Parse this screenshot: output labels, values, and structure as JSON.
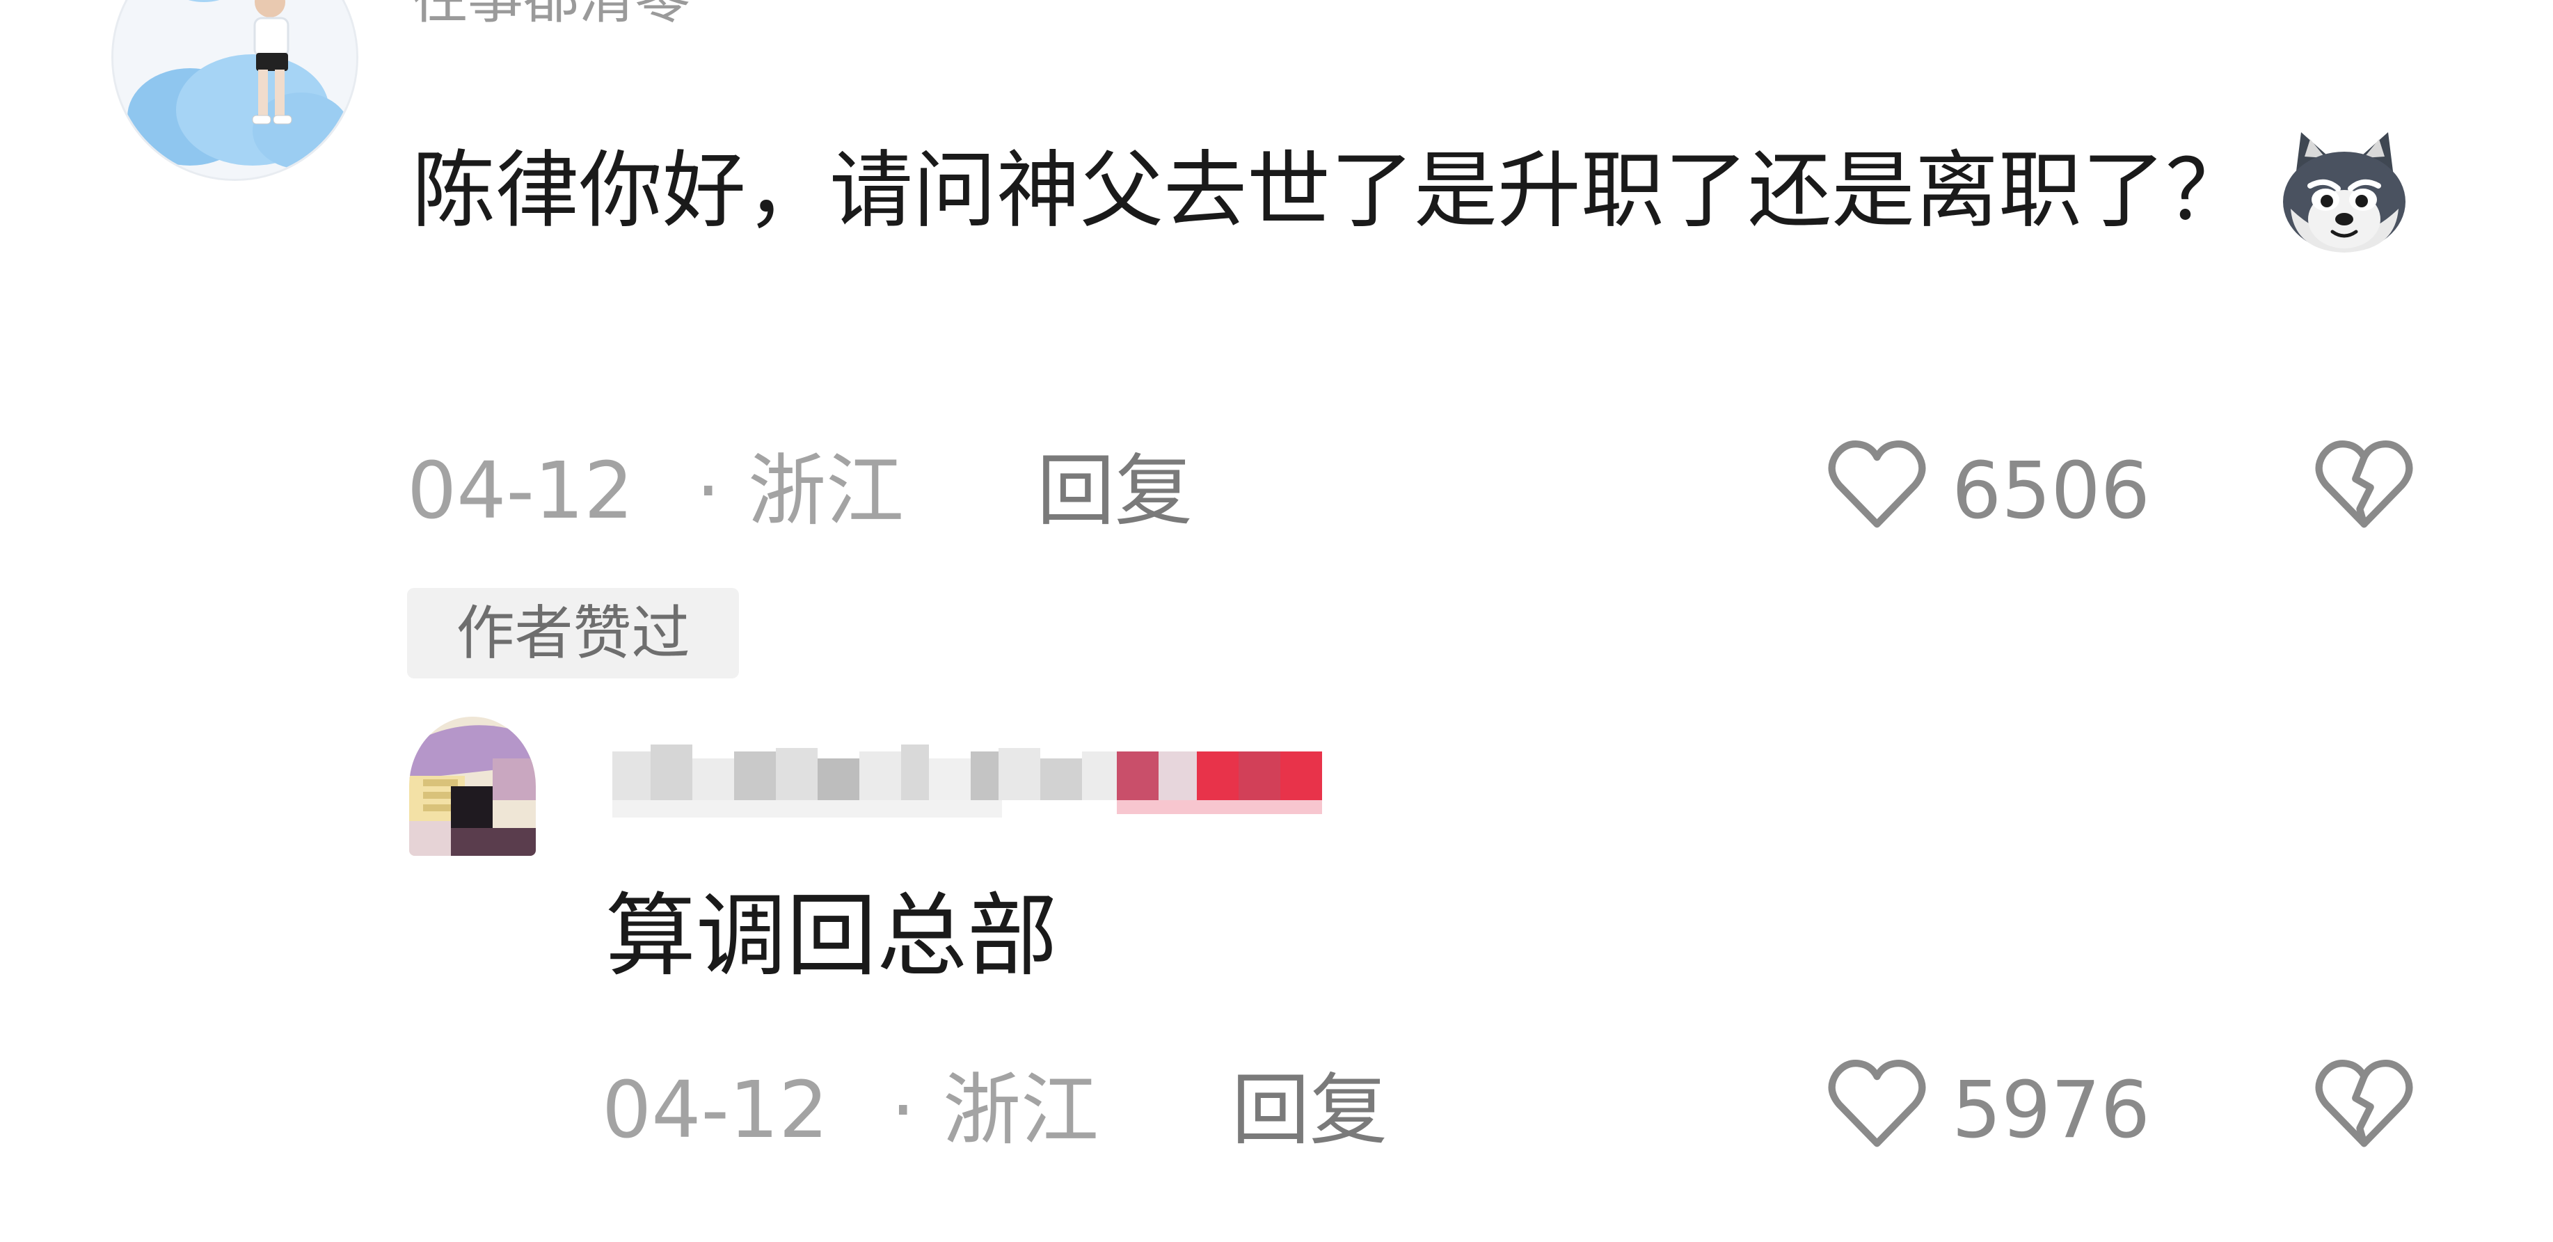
{
  "comment": {
    "username": "往事都清零",
    "text": "陈律你好，请问神父去世了是升职了还是离职了？",
    "sticker": "husky-sticker",
    "date": "04-12",
    "separator": "·",
    "location": "浙江",
    "reply_label": "回复",
    "like_count": "6506",
    "like_icon": "heart-outline-icon",
    "dislike_icon": "broken-heart-icon",
    "badge": "作者赞过"
  },
  "reply": {
    "username_pixelated": true,
    "author_tag_color": "#e8334a",
    "text": "算调回总部",
    "date": "04-12",
    "separator": "·",
    "location": "浙江",
    "reply_label": "回复",
    "like_count": "5976",
    "like_icon": "heart-outline-icon",
    "dislike_icon": "broken-heart-icon"
  },
  "colors": {
    "primary_text": "#1a1a1a",
    "meta_text": "#a3a3a3",
    "icon": "#8a8a8a",
    "badge_bg": "#f1f1f1"
  }
}
